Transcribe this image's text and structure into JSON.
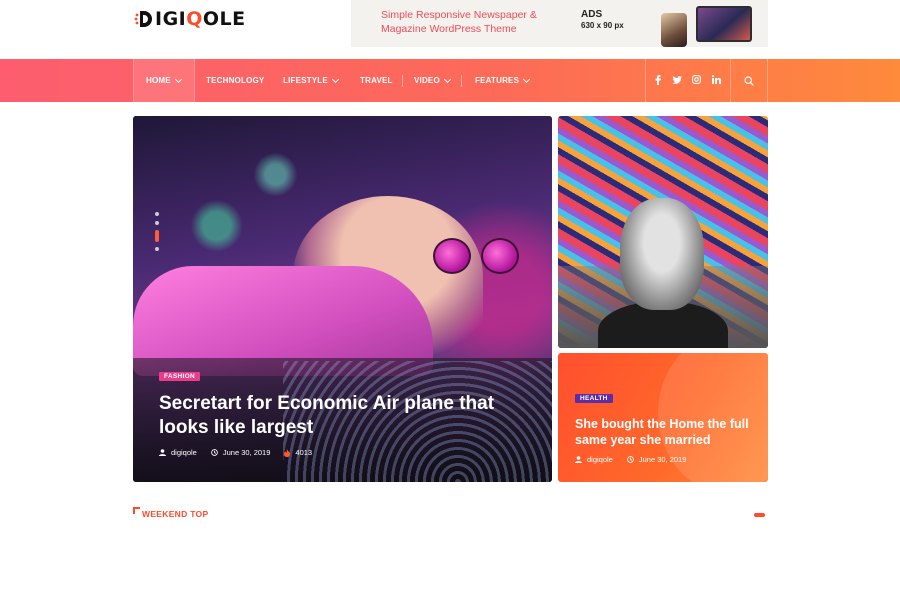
{
  "header": {
    "logo": {
      "prefix": "D",
      "rest_left": "IGI",
      "accent": "Q",
      "rest_right": "OLE"
    },
    "ad": {
      "line1": "Simple Responsive Newspaper &",
      "line2": "Magazine WordPress Theme",
      "title": "ADS",
      "size": "630 x 90 px"
    }
  },
  "nav": {
    "items": [
      {
        "label": "HOME",
        "has_dropdown": true,
        "active": true
      },
      {
        "label": "TECHNOLOGY",
        "has_dropdown": false
      },
      {
        "label": "LIFESTYLE",
        "has_dropdown": true
      },
      {
        "label": "TRAVEL",
        "has_dropdown": false
      },
      {
        "label": "VIDEO",
        "has_dropdown": true
      },
      {
        "label": "FEATURES",
        "has_dropdown": true
      }
    ],
    "social": [
      "f",
      "t",
      "ig",
      "in"
    ],
    "social_icons": [
      "facebook-icon",
      "twitter-icon",
      "instagram-icon",
      "linkedin-icon"
    ]
  },
  "hero": {
    "category": "FASHION",
    "title": "Secretart for Economic Air plane that looks like largest",
    "author": "digiqole",
    "date": "June 30, 2019",
    "views": "4013"
  },
  "side_post": {
    "category": "HEALTH",
    "title": "She bought the Home the full same year she married",
    "author": "digiqole",
    "date": "June 30, 2019"
  },
  "section": {
    "weekend_title": "WEEKEND TOP"
  },
  "colors": {
    "accent": "#ff4b2b",
    "nav_start": "#fd5d6f",
    "nav_end": "#fe8a3c",
    "fashion_tag": "#e93d8b",
    "health_tag": "#5b2ea6"
  }
}
